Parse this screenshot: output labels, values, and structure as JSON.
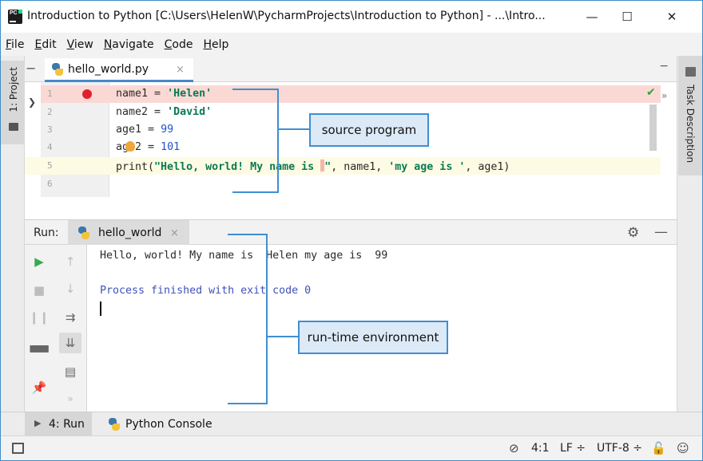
{
  "window": {
    "title": "Introduction to Python [C:\\Users\\HelenW\\PycharmProjects\\Introduction to Python] - ...\\Intro...",
    "app_icon_text": "PC",
    "controls": {
      "minimize": "—",
      "maximize": "☐",
      "close": "✕"
    }
  },
  "menu": [
    "File",
    "Edit",
    "View",
    "Navigate",
    "Code",
    "Help"
  ],
  "left_strip": {
    "project_label": "1: Project"
  },
  "right_strip": {
    "task_label": "Task Description"
  },
  "editor": {
    "tab_label": "hello_world.py",
    "tab_close": "×",
    "line_numbers": [
      "1",
      "2",
      "3",
      "4",
      "5",
      "6"
    ],
    "lines": [
      {
        "ident": "name1",
        "op": " = ",
        "str": "'Helen'"
      },
      {
        "ident": "name2",
        "op": " = ",
        "str": "'David'"
      },
      {
        "ident": "age1",
        "op": " = ",
        "num": "99"
      },
      {
        "ident": "age2",
        "op": " = ",
        "num": "101"
      },
      {
        "fn": "print(",
        "s1": "\"Hello, world! My name is ",
        "s1end": "\"",
        "mid": ", name1, ",
        "s2": "'my age is '",
        "end": ", age1)"
      }
    ],
    "check_icon": "✔",
    "more_icon": "»"
  },
  "run_panel": {
    "label": "Run:",
    "tab_label": "hello_world",
    "tab_close": "×",
    "console": [
      "Hello, world! My name is  Helen my age is  99",
      "Process finished with exit code 0"
    ]
  },
  "bottom_tabs": {
    "run_label": "4: Run",
    "console_label": "Python Console"
  },
  "status": {
    "position": "4:1",
    "line_sep": "LF ÷",
    "encoding": "UTF-8 ÷"
  },
  "annotations": {
    "source": "source program",
    "runtime": "run-time environment"
  },
  "colors": {
    "accent": "#3f8fd2",
    "callout_bg": "#dce9f7",
    "string": "#0a7a54",
    "number": "#2252c8",
    "breakpoint": "#e0212d"
  }
}
